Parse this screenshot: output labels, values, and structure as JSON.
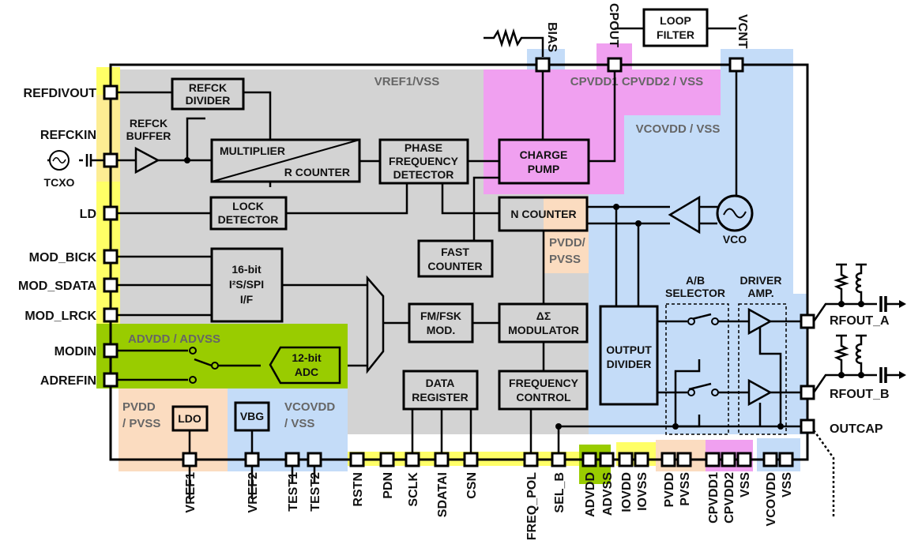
{
  "pins": {
    "left": [
      "REFDIVOUT",
      "REFCKIN",
      "LD",
      "MOD_BICK",
      "MOD_SDATA",
      "MOD_LRCK",
      "MODIN",
      "ADREFIN"
    ],
    "top": [
      "BIAS",
      "CPOUT",
      "VCNT"
    ],
    "right": [
      "RFOUT_A",
      "RFOUT_B",
      "OUTCAP"
    ],
    "bottom": [
      "VREF1",
      "VREF2",
      "TEST1",
      "TEST2",
      "RSTN",
      "PDN",
      "SCLK",
      "SDATAI",
      "CSN",
      "FREQ_POL",
      "SEL_B",
      "ADVDD",
      "ADVSS",
      "IOVDD",
      "IOVSS",
      "PVDD",
      "PVSS",
      "CPVDD1",
      "CPVDD2",
      "VSS",
      "VCOVDD",
      "VSS"
    ]
  },
  "blocks": {
    "refck_divider": [
      "REFCK",
      "DIVIDER"
    ],
    "refck_buffer": [
      "REFCK",
      "BUFFER"
    ],
    "multiplier": "MULTIPLIER",
    "r_counter": "R COUNTER",
    "pfd": [
      "PHASE",
      "FREQUENCY",
      "DETECTOR"
    ],
    "charge_pump": [
      "CHARGE",
      "PUMP"
    ],
    "lock_detector": [
      "LOCK",
      "DETECTOR"
    ],
    "n_counter": "N COUNTER",
    "fast_counter": [
      "FAST",
      "COUNTER"
    ],
    "i2s_spi": [
      "16-bit",
      "I²S/SPI",
      "I/F"
    ],
    "adc": [
      "12-bit",
      "ADC"
    ],
    "fm_fsk": [
      "FM/FSK",
      "MOD."
    ],
    "dsm": [
      "ΔΣ",
      "MODULATOR"
    ],
    "data_register": [
      "DATA",
      "REGISTER"
    ],
    "frequency_control": [
      "FREQUENCY",
      "CONTROL"
    ],
    "output_divider": [
      "OUTPUT",
      "DIVIDER"
    ],
    "ab_selector": [
      "A/B",
      "SELECTOR"
    ],
    "driver_amp": [
      "DRIVER",
      "AMP."
    ],
    "loop_filter": [
      "LOOP",
      "FILTER"
    ],
    "ldo": "LDO",
    "vbg": "VBG",
    "vco": "VCO",
    "tcxo": "TCXO"
  },
  "domains": {
    "vref1": "VREF1/VSS",
    "cpvdd": "CPVDD1  CPVDD2 / VSS",
    "vcovdd_top": "VCOVDD / VSS",
    "pvdd_n": [
      "PVDD/",
      "PVSS"
    ],
    "advdd": "ADVDD / ADVSS",
    "pvdd_ldo": [
      "PVDD",
      "/ PVSS"
    ],
    "vcovdd_vbg": [
      "VCOVDD",
      "/ VSS"
    ]
  },
  "colors": {
    "core": "#d3d3d3",
    "charge_pump": "#f0a0f0",
    "vco": "#c4dcf8",
    "adc": "#99cc00",
    "pvdd": "#fbdcc0",
    "io": "#ffff00"
  }
}
